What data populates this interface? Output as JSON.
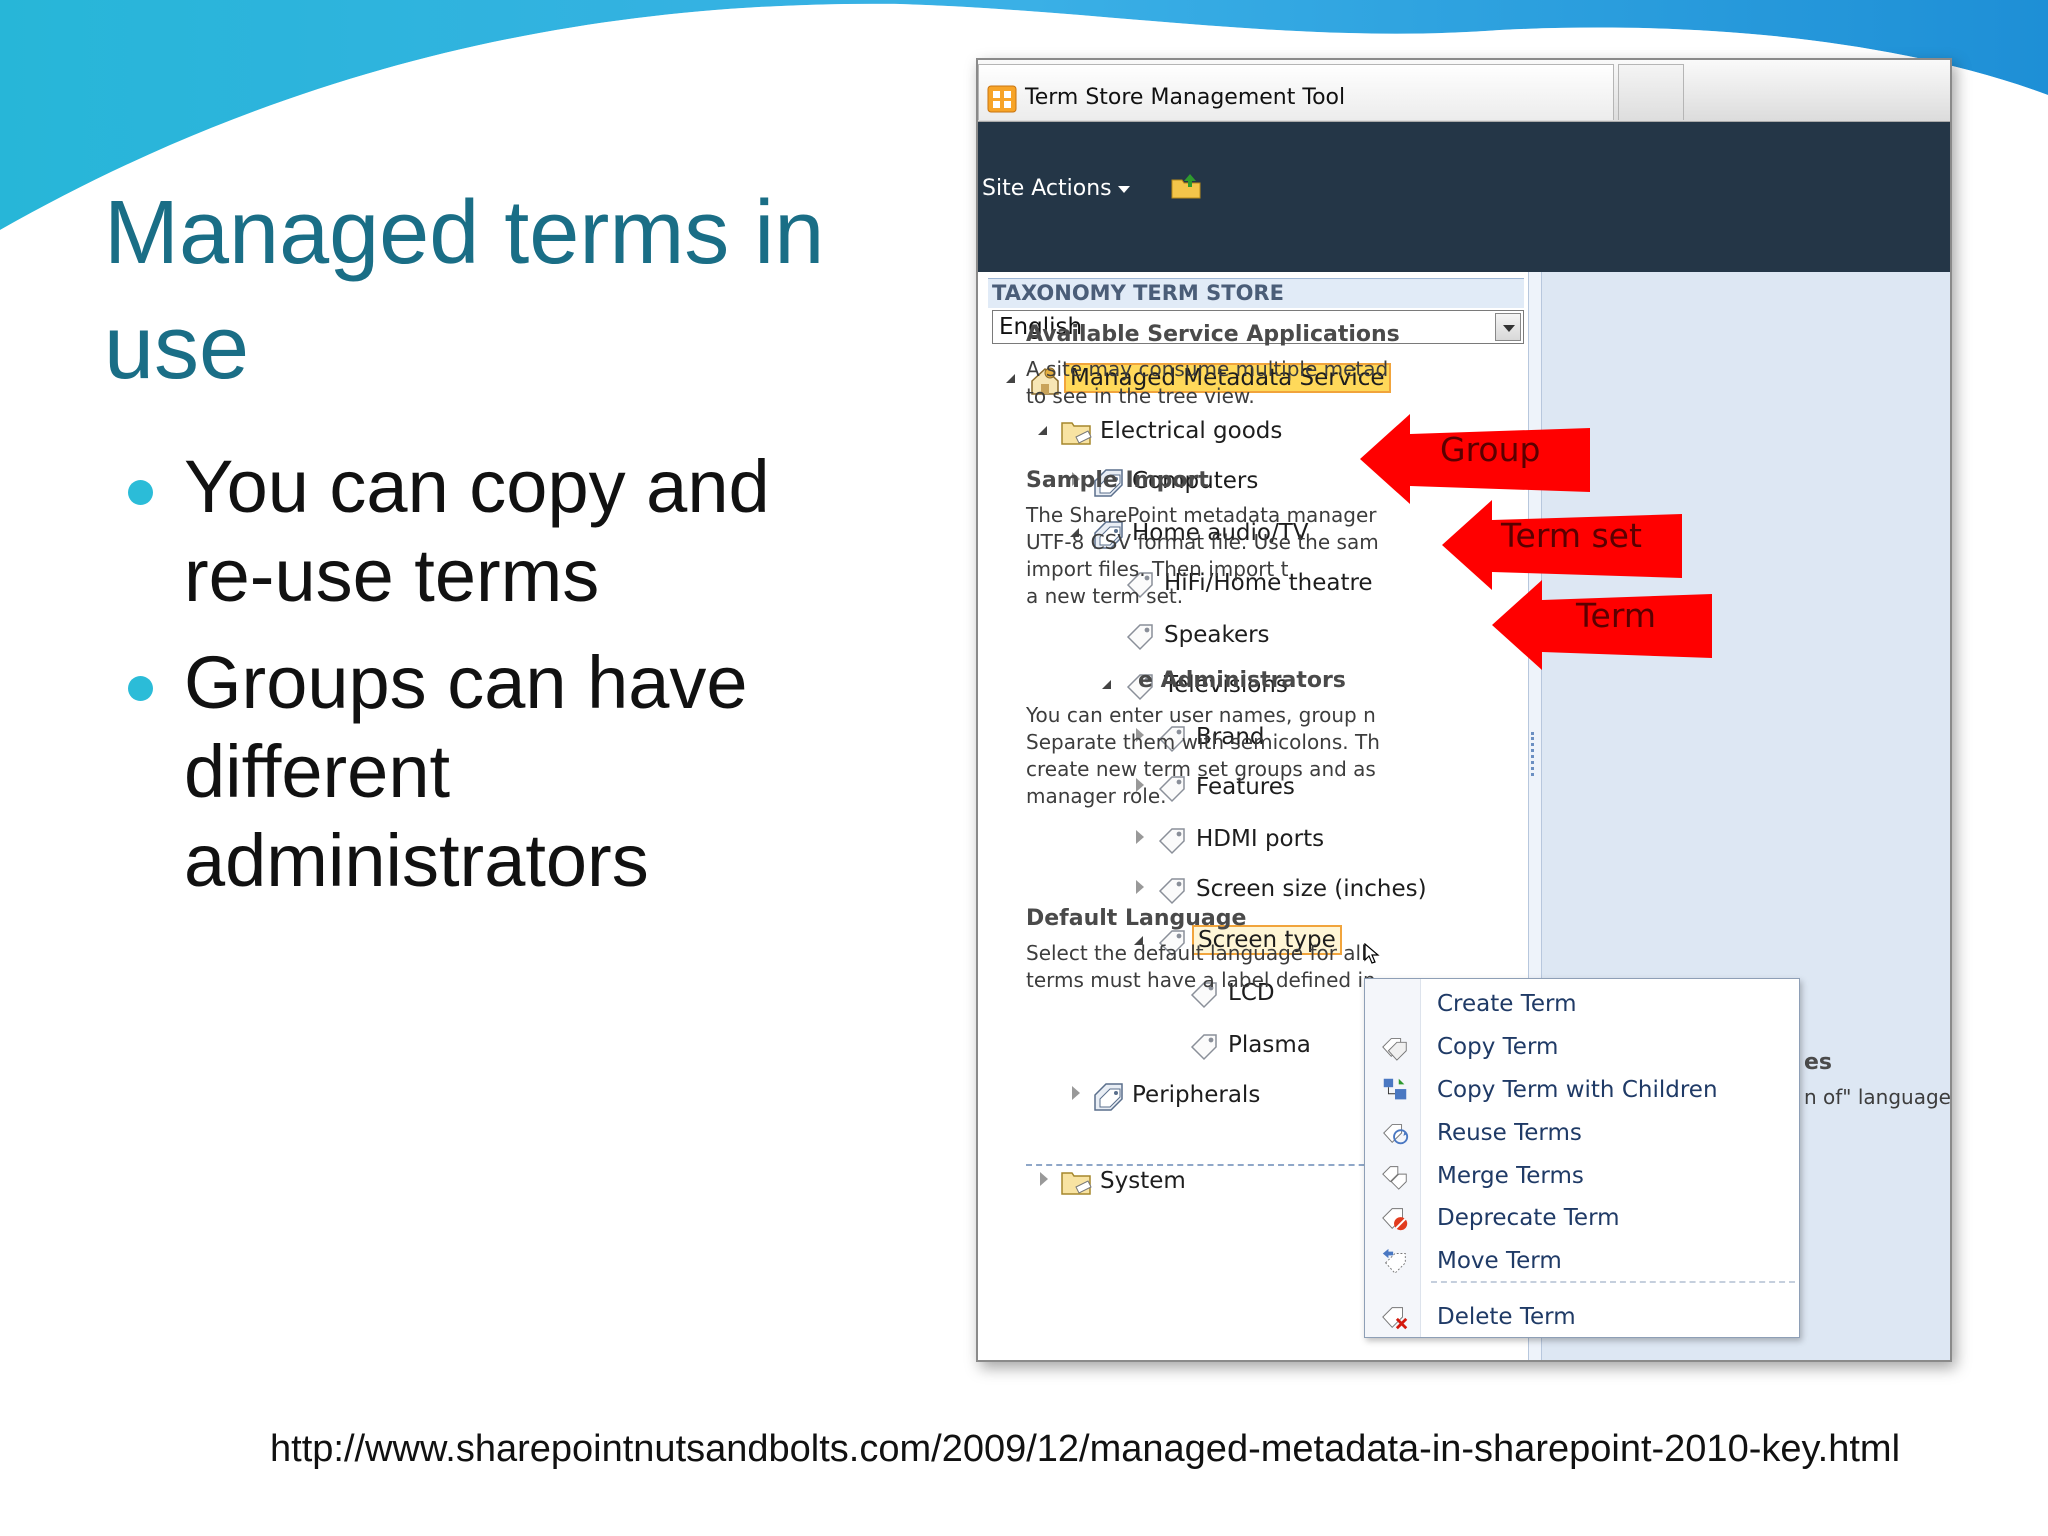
{
  "slide": {
    "title": "Managed terms in use",
    "bullets": [
      "You can copy and re-use terms",
      "Groups can have different administrators"
    ],
    "footer_url": "http://www.sharepointnutsandbolts.com/2009/12/managed-metadata-in-sharepoint-2010-key.html",
    "accent_color": "#2bbcd8",
    "title_color": "#1a6e86"
  },
  "window": {
    "title": "Term Store Management Tool",
    "site_actions": "Site Actions",
    "app_icon": "term-store-icon",
    "up_icon": "folder-up-icon"
  },
  "taxonomy": {
    "header": "TAXONOMY TERM STORE",
    "language": "English",
    "nodes": [
      {
        "label": "Managed Metadata Service",
        "icon": "metadata-service-icon"
      },
      {
        "label": "Electrical goods",
        "icon": "group-folder-icon"
      },
      {
        "label": "Computers",
        "icon": "term-set-icon"
      },
      {
        "label": "Home audio/TV",
        "icon": "term-set-icon"
      },
      {
        "label": "HiFi/Home theatre",
        "icon": "term-tag-icon"
      },
      {
        "label": "Speakers",
        "icon": "term-tag-icon"
      },
      {
        "label": "Televisions",
        "icon": "term-tag-icon"
      },
      {
        "label": "Brand",
        "icon": "term-tag-icon"
      },
      {
        "label": "Features",
        "icon": "term-tag-icon"
      },
      {
        "label": "HDMI ports",
        "icon": "term-tag-icon"
      },
      {
        "label": "Screen size (inches)",
        "icon": "term-tag-icon"
      },
      {
        "label": "Screen type",
        "icon": "term-tag-icon"
      },
      {
        "label": "LCD",
        "icon": "term-tag-icon"
      },
      {
        "label": "Plasma",
        "icon": "term-tag-icon"
      },
      {
        "label": "Peripherals",
        "icon": "term-set-icon"
      },
      {
        "label": "System",
        "icon": "group-folder-icon"
      }
    ]
  },
  "callouts": {
    "group": "Group",
    "term_set": "Term set",
    "term": "Term",
    "color": "#ff0000"
  },
  "right_panel": {
    "available_heading": "Available Service Applications",
    "available_text": "A site may consume multiple metad\nto see in the tree view.",
    "import_heading": "Sample Import",
    "import_text": "The SharePoint metadata manager\nUTF-8 CSV format file. Use the sam\nimport files. Then import t\na new term set.",
    "admins_heading": "e Administrators",
    "admins_text": "You can enter user names, group n\nSeparate them with semicolons. Th\ncreate new term set groups and as\nmanager role.",
    "language_heading": "Default Language",
    "language_text": "Select the default language for all\nterms must have a label defined in",
    "partial_heading": "es",
    "partial_text": "n of\" language"
  },
  "context_menu": {
    "items": [
      {
        "label": "Create Term",
        "icon": "create-term-icon"
      },
      {
        "label": "Copy Term",
        "icon": "copy-term-icon"
      },
      {
        "label": "Copy Term with Children",
        "icon": "copy-children-icon"
      },
      {
        "label": "Reuse Terms",
        "icon": "reuse-terms-icon"
      },
      {
        "label": "Merge Terms",
        "icon": "merge-terms-icon"
      },
      {
        "label": "Deprecate Term",
        "icon": "deprecate-term-icon"
      },
      {
        "label": "Move Term",
        "icon": "move-term-icon"
      },
      {
        "label": "Delete Term",
        "icon": "delete-term-icon"
      }
    ]
  }
}
